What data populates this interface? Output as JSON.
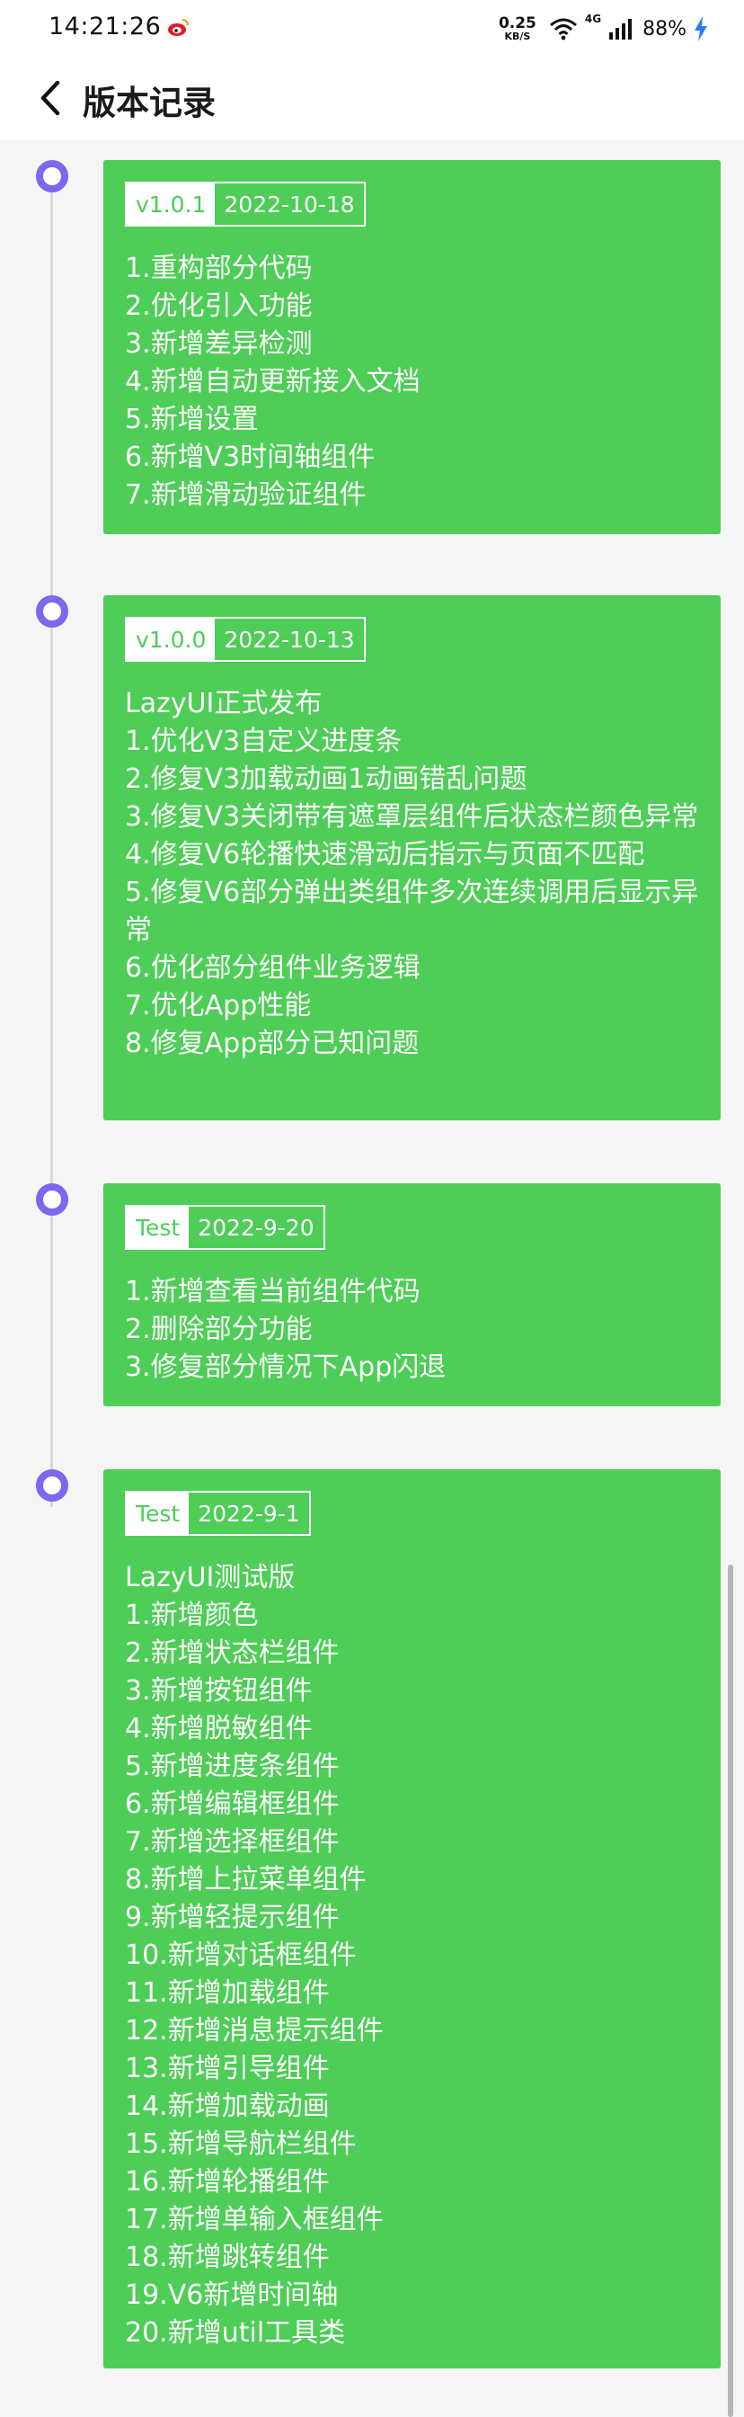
{
  "status_bar": {
    "time": "14:21:26",
    "net_speed_value": "0.25",
    "net_speed_unit": "KB/S",
    "network_label": "4G",
    "battery": "88%"
  },
  "header": {
    "title": "版本记录"
  },
  "colors": {
    "card_green": "#4ecd57",
    "timeline_dot": "#7b68ee"
  },
  "releases": [
    {
      "version": "v1.0.1",
      "date": "2022-10-18",
      "items": [
        "1.重构部分代码",
        "2.优化引入功能",
        "3.新增差异检测",
        "4.新增自动更新接入文档",
        "5.新增设置",
        "6.新增V3时间轴组件",
        "7.新增滑动验证组件"
      ]
    },
    {
      "version": "v1.0.0",
      "date": "2022-10-13",
      "items": [
        "LazyUI正式发布",
        "1.优化V3自定义进度条",
        "2.修复V3加载动画1动画错乱问题",
        "3.修复V3关闭带有遮罩层组件后状态栏颜色异常",
        "4.修复V6轮播快速滑动后指示与页面不匹配",
        "5.修复V6部分弹出类组件多次连续调用后显示异常",
        "6.优化部分组件业务逻辑",
        "7.优化App性能",
        "8.修复App部分已知问题"
      ]
    },
    {
      "version": "Test",
      "date": "2022-9-20",
      "items": [
        "1.新增查看当前组件代码",
        "2.删除部分功能",
        "3.修复部分情况下App闪退"
      ]
    },
    {
      "version": "Test",
      "date": "2022-9-1",
      "items": [
        "LazyUI测试版",
        "1.新增颜色",
        "2.新增状态栏组件",
        "3.新增按钮组件",
        "4.新增脱敏组件",
        "5.新增进度条组件",
        "6.新增编辑框组件",
        "7.新增选择框组件",
        "8.新增上拉菜单组件",
        "9.新增轻提示组件",
        "10.新增对话框组件",
        "11.新增加载组件",
        "12.新增消息提示组件",
        "13.新增引导组件",
        "14.新增加载动画",
        "15.新增导航栏组件",
        "16.新增轮播组件",
        "17.新增单输入框组件",
        "18.新增跳转组件",
        "19.V6新增时间轴",
        "20.新增util工具类"
      ]
    }
  ]
}
